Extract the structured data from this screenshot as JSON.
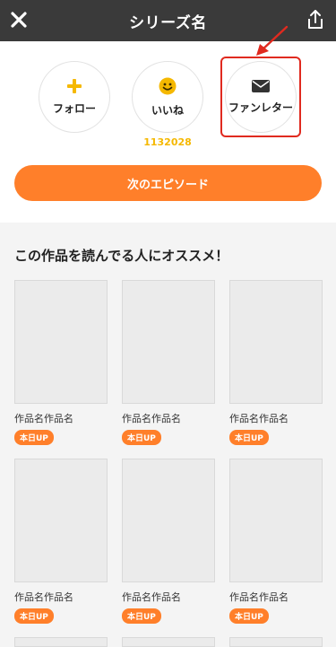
{
  "header": {
    "title": "シリーズ名",
    "close_icon": "close-icon",
    "share_icon": "share-icon"
  },
  "actions": {
    "follow_label": "フォロー",
    "like_label": "いいね",
    "like_count": "1132028",
    "letter_label": "ファンレター"
  },
  "next_episode_label": "次のエピソード",
  "recommend": {
    "title": "この作品を読んでる人にオススメ！",
    "items": [
      {
        "name": "作品名作品名",
        "badge": "本日UP"
      },
      {
        "name": "作品名作品名",
        "badge": "本日UP"
      },
      {
        "name": "作品名作品名",
        "badge": "本日UP"
      },
      {
        "name": "作品名作品名",
        "badge": "本日UP"
      },
      {
        "name": "作品名作品名",
        "badge": "本日UP"
      },
      {
        "name": "作品名作品名",
        "badge": "本日UP"
      }
    ]
  },
  "colors": {
    "accent": "#ff7f2a",
    "like_count": "#f5b800",
    "highlight": "#e02a1f",
    "header_bg": "#3a3a3a"
  }
}
